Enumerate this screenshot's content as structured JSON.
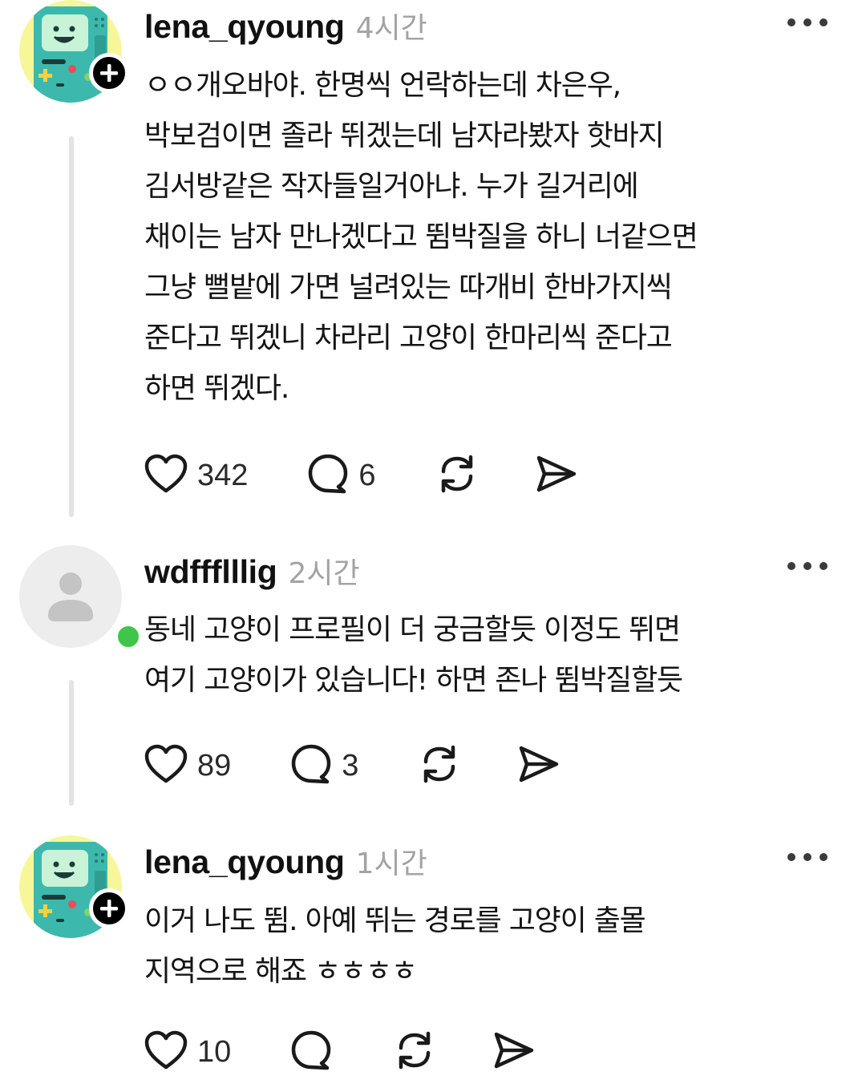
{
  "threads": [
    {
      "username": "lena_qyoung",
      "time": "4시간",
      "text": "ㅇㅇ개오바야. 한명씩 언락하는데 차은우,\n박보검이면 졸라 뛰겠는데 남자라봤자 핫바지\n김서방같은 작자들일거아냐. 누가 길거리에\n채이는 남자 만나겠다고 뜀박질을 하니 너같으면\n그냥 뻘밭에 가면 널려있는 따개비 한바가지씩\n준다고 뛰겠니 차라리 고양이 한마리씩 준다고\n하면 뛰겠다.",
      "likes": "342",
      "replies": "6",
      "avatar": "bmo-avatar",
      "badge": "follow-plus"
    },
    {
      "username": "wdffflllig",
      "time": "2시간",
      "text": "동네 고양이 프로필이 더 궁금할듯 이정도 뛰면\n여기 고양이가 있습니다! 하면 존나 뜀박질할듯",
      "likes": "89",
      "replies": "3",
      "avatar": "default-person-avatar",
      "badge": "online-dot"
    },
    {
      "username": "lena_qyoung",
      "time": "1시간",
      "text": "이거 나도 뜀. 아예 뛰는 경로를 고양이 출몰\n지역으로 해죠 ㅎㅎㅎㅎ",
      "likes": "10",
      "replies": "",
      "avatar": "bmo-avatar",
      "badge": "follow-plus"
    }
  ],
  "icons": {
    "like": "heart-icon",
    "reply": "comment-bubble-icon",
    "repost": "repost-icon",
    "share": "send-icon",
    "more": "more-dots-icon"
  },
  "colors": {
    "online": "#3fc64a",
    "secondary_text": "#a3a3a3",
    "thread_line": "#e3e3e3"
  }
}
